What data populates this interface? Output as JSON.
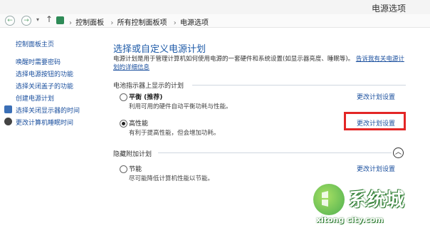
{
  "window": {
    "title": "电源选项"
  },
  "address": {
    "crumbs": [
      "控制面板",
      "所有控制面板项",
      "电源选项"
    ],
    "separator": "›",
    "up_icon": "up-arrow-icon",
    "cp_icon": "control-panel-icon"
  },
  "nav": {
    "home": "控制面板主页",
    "items": [
      {
        "label": "唤醒时需要密码",
        "icon": null
      },
      {
        "label": "选择电源按钮的功能",
        "icon": null
      },
      {
        "label": "选择关闭盖子的功能",
        "icon": null
      },
      {
        "label": "创建电源计划",
        "icon": null
      },
      {
        "label": "选择关闭显示器的时间",
        "icon": "monitor-icon"
      },
      {
        "label": "更改计算机睡眠时间",
        "icon": "moon-icon"
      }
    ]
  },
  "main": {
    "title": "选择或自定义电源计划",
    "intro_text": "电源计划是用于管理计算机如何使用电源的一套硬件和系统设置(如显示器亮度、睡眠等)。",
    "intro_link_a": "告诉我有关电源计",
    "intro_link_b": "划的详细信息",
    "battery_section": "电池指示器上显示的计划",
    "hidden_section": "隐藏附加计划",
    "change_link": "更改计划设置",
    "plans": [
      {
        "name": "平衡 (推荐)",
        "desc": "利用可用的硬件自动平衡功耗与性能。",
        "checked": false
      },
      {
        "name": "高性能",
        "desc": "有利于提高性能，但会增加功耗。",
        "checked": true
      },
      {
        "name": "节能",
        "desc": "尽可能降低计算机性能以节能。",
        "checked": false
      }
    ]
  },
  "watermark": {
    "text": "系统城",
    "url": "xitong city.com"
  },
  "colors": {
    "link": "#1a4f9e",
    "title": "#1d5aa8",
    "highlight": "#e32626"
  }
}
